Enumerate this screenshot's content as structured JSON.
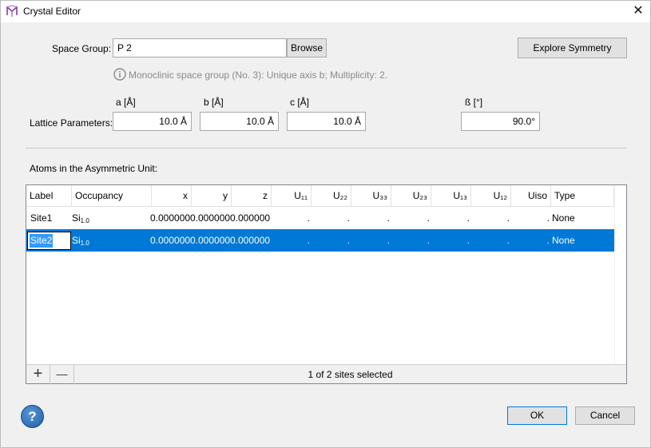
{
  "window": {
    "title": "Crystal Editor",
    "close_glyph": "✕"
  },
  "space_group": {
    "label": "Space Group:",
    "value": "P 2",
    "browse_label": "Browse",
    "info_text": "Monoclinic space group (No. 3): Unique axis b; Multiplicity: 2.",
    "explore_label": "Explore Symmetry"
  },
  "lattice": {
    "label": "Lattice Parameters:",
    "a": {
      "header": "a [Å]",
      "value": "10.0 Å"
    },
    "b": {
      "header": "b [Å]",
      "value": "10.0 Å"
    },
    "c": {
      "header": "c [Å]",
      "value": "10.0 Å"
    },
    "beta": {
      "header": "ß [°]",
      "value": "90.0°"
    }
  },
  "atoms": {
    "section_label": "Atoms in the Asymmetric Unit:",
    "columns": {
      "label": "Label",
      "occupancy": "Occupancy",
      "x": "x",
      "y": "y",
      "z": "z",
      "u11": "U₁₁",
      "u22": "U₂₂",
      "u33": "U₃₃",
      "u23": "U₂₃",
      "u13": "U₁₃",
      "u12": "U₁₂",
      "uiso": "Uiso",
      "type": "Type"
    },
    "rows": [
      {
        "label": "Site1",
        "occ_el": "Si",
        "occ_num": "1.0",
        "x": "0.000000",
        "y": "0.000000",
        "z": "0.000000",
        "u11": ".",
        "u22": ".",
        "u33": ".",
        "u23": ".",
        "u13": ".",
        "u12": ".",
        "uiso": ".",
        "type": "None"
      },
      {
        "label": "Site2",
        "occ_el": "Si",
        "occ_num": "1.0",
        "x": "0.000000",
        "y": "0.000000",
        "z": "0.000000",
        "u11": ".",
        "u22": ".",
        "u33": ".",
        "u23": ".",
        "u13": ".",
        "u12": ".",
        "uiso": ".",
        "type": "None"
      }
    ],
    "add_glyph": "+",
    "remove_glyph": "—",
    "status": "1 of 2 sites selected"
  },
  "buttons": {
    "help_glyph": "?",
    "ok_label": "OK",
    "cancel_label": "Cancel"
  },
  "colors": {
    "selection": "#0078d7",
    "help": "#1e5ea8"
  }
}
